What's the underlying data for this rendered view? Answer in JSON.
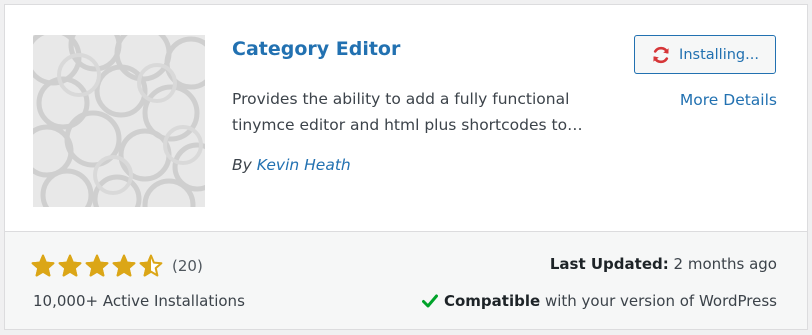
{
  "plugin": {
    "name": "Category Editor",
    "description": "Provides the ability to add a fully functional tinymce editor and html plus shortcodes to…",
    "author_prefix": "By",
    "author_name": "Kevin Heath",
    "thumbnail_icon": "circles-pattern-icon"
  },
  "actions": {
    "install_label": "Installing...",
    "install_icon": "update-spinner-icon",
    "more_details_label": "More Details"
  },
  "stats": {
    "rating": 4.5,
    "rating_max": 5,
    "rating_count": "(20)",
    "active_installs": "10,000+ Active Installations",
    "last_updated_label": "Last Updated:",
    "last_updated_value": "2 months ago",
    "compat_strong": "Compatible",
    "compat_rest": "with your version of WordPress",
    "compat_icon": "checkmark-icon"
  },
  "colors": {
    "link": "#2271b1",
    "star": "#dba617",
    "check": "#00a32a",
    "spinner": "#d63638"
  }
}
